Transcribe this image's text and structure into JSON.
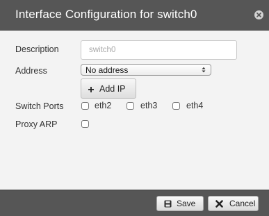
{
  "dialog": {
    "title": "Interface Configuration for switch0",
    "close_icon": "close-icon"
  },
  "form": {
    "description": {
      "label": "Description",
      "placeholder": "switch0",
      "value": ""
    },
    "address": {
      "label": "Address",
      "selected": "No address",
      "add_ip_label": "Add IP",
      "add_icon": "plus-icon"
    },
    "switch_ports": {
      "label": "Switch Ports",
      "ports": [
        {
          "name": "eth2",
          "checked": false
        },
        {
          "name": "eth3",
          "checked": false
        },
        {
          "name": "eth4",
          "checked": false
        }
      ]
    },
    "proxy_arp": {
      "label": "Proxy ARP",
      "checked": false
    }
  },
  "footer": {
    "save_label": "Save",
    "save_icon": "floppy-disk-icon",
    "cancel_label": "Cancel",
    "cancel_icon": "x-icon"
  },
  "colors": {
    "titlebar": "#565656",
    "body": "#f3f3f3",
    "footer": "#565656"
  }
}
